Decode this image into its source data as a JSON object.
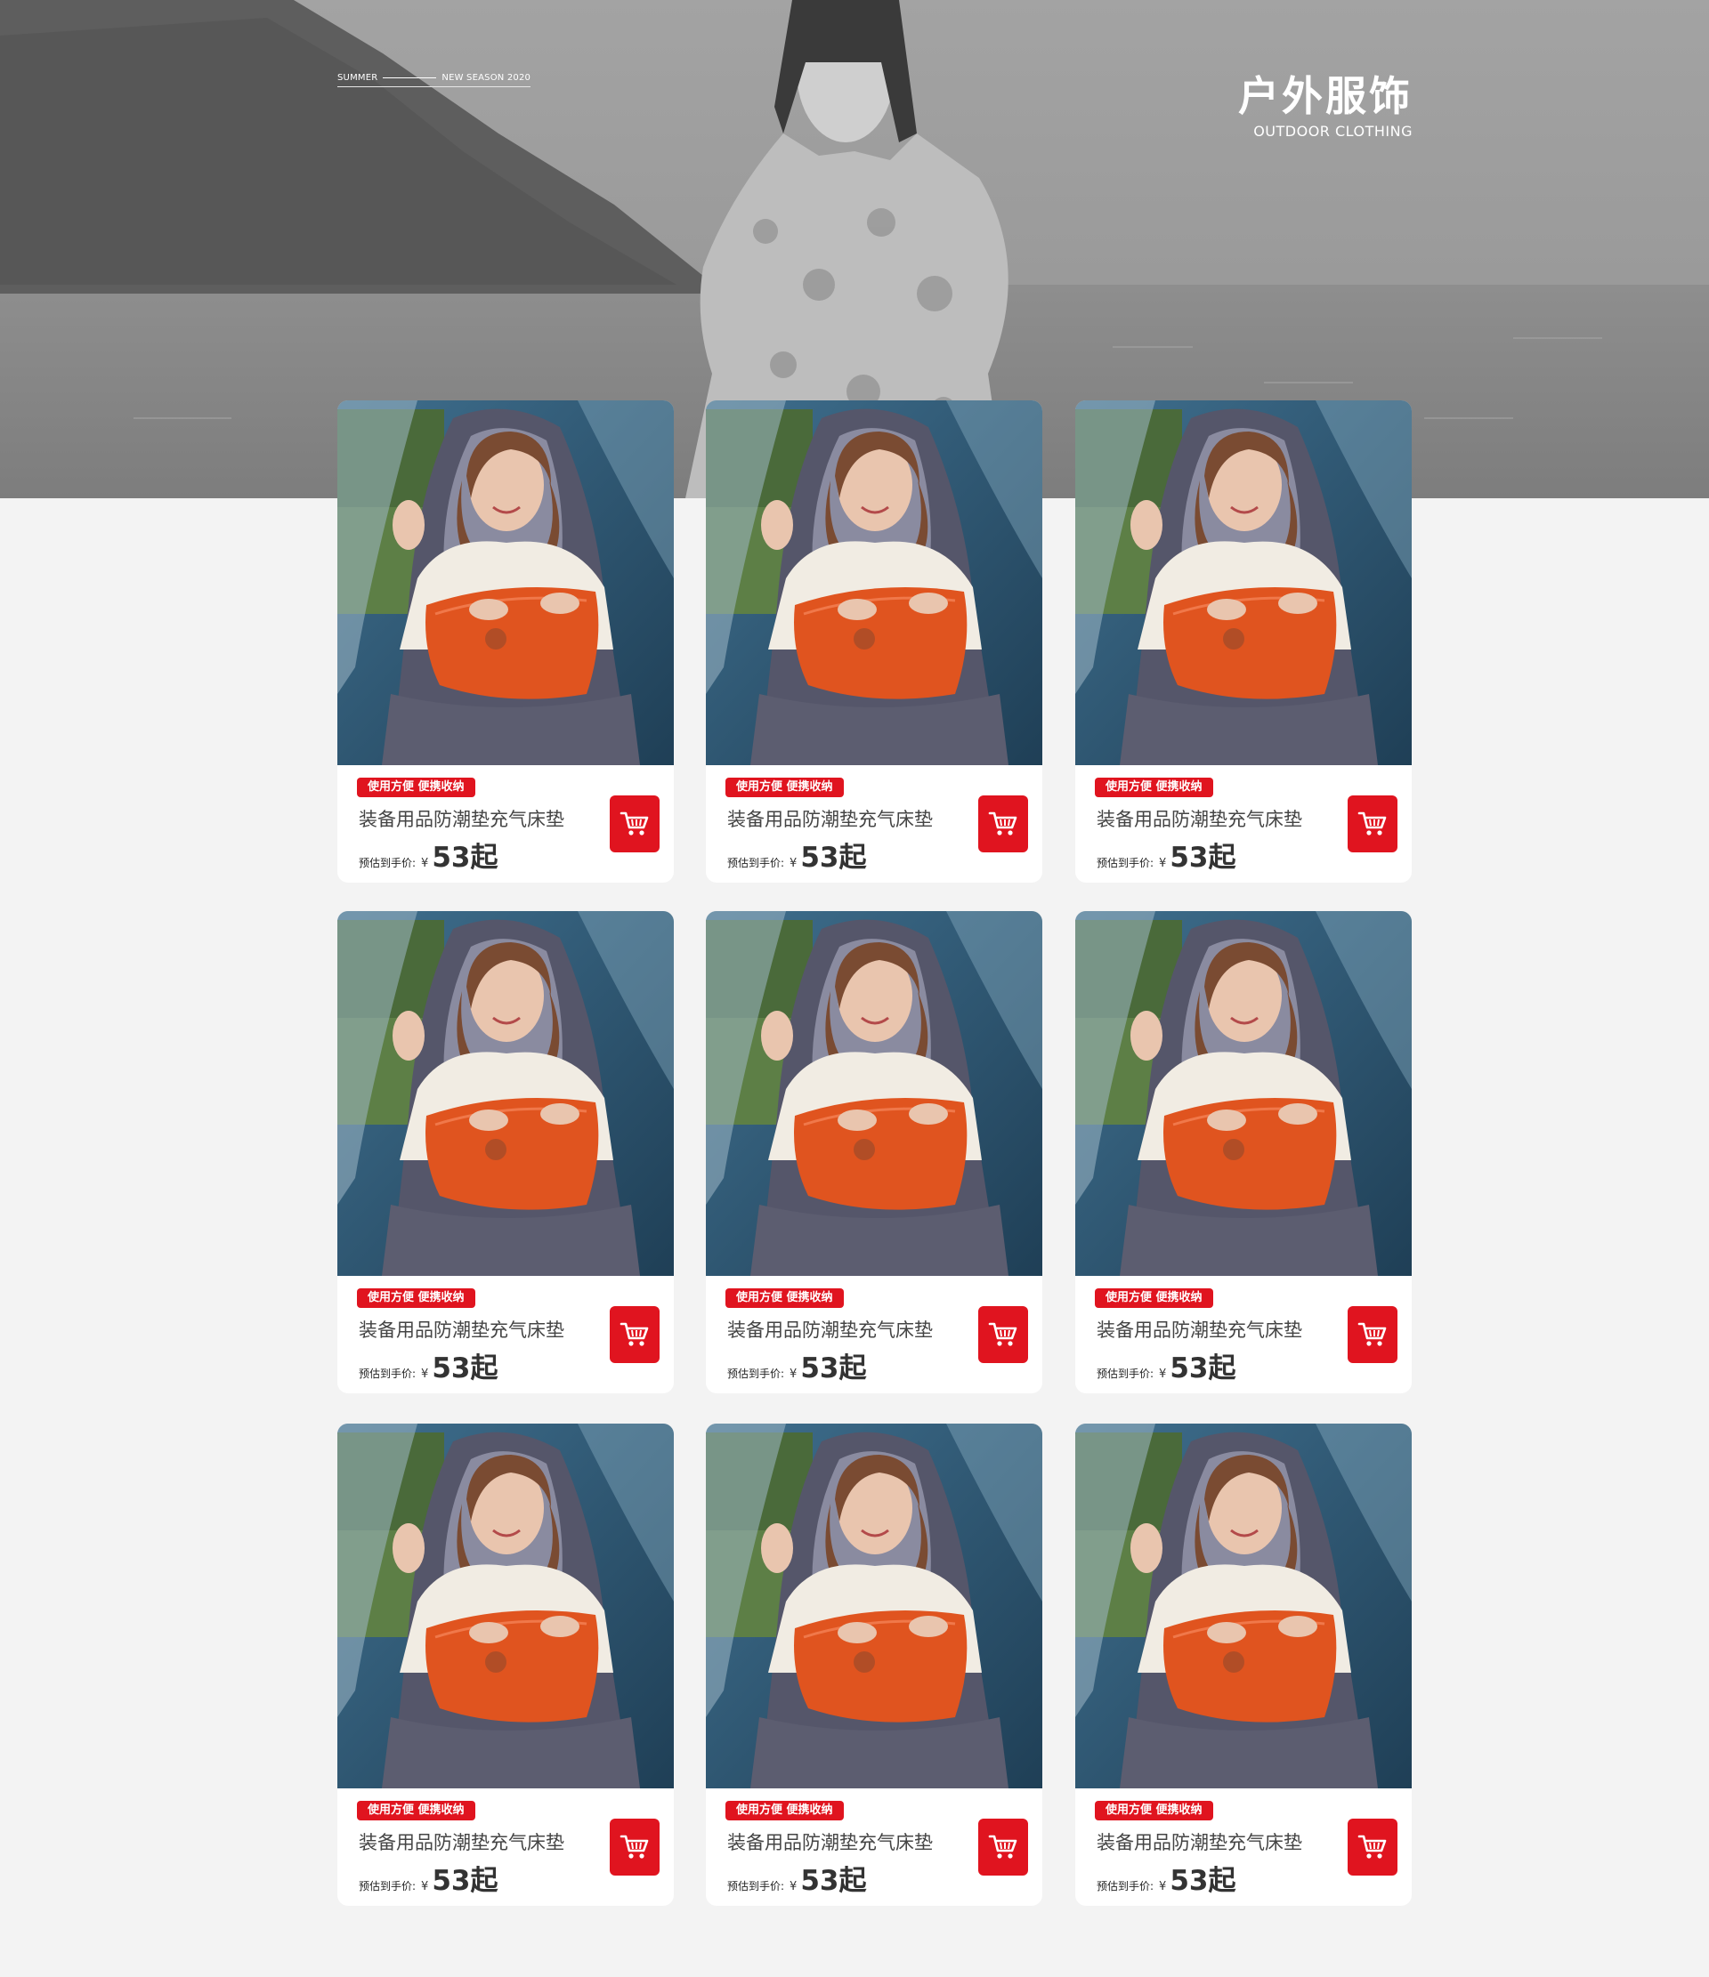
{
  "hero": {
    "season_left": "SUMMER",
    "season_right": "NEW SEASON 2020",
    "title_cn": "户外服饰",
    "title_en": "OUTDOOR CLOTHING"
  },
  "products": [
    {
      "tag": "使用方便 便携收纳",
      "name": "装备用品防潮垫充气床垫",
      "price_label": "预估到手价:",
      "currency": "¥",
      "price": "53起"
    },
    {
      "tag": "使用方便 便携收纳",
      "name": "装备用品防潮垫充气床垫",
      "price_label": "预估到手价:",
      "currency": "¥",
      "price": "53起"
    },
    {
      "tag": "使用方便 便携收纳",
      "name": "装备用品防潮垫充气床垫",
      "price_label": "预估到手价:",
      "currency": "¥",
      "price": "53起"
    },
    {
      "tag": "使用方便 便携收纳",
      "name": "装备用品防潮垫充气床垫",
      "price_label": "预估到手价:",
      "currency": "¥",
      "price": "53起"
    },
    {
      "tag": "使用方便 便携收纳",
      "name": "装备用品防潮垫充气床垫",
      "price_label": "预估到手价:",
      "currency": "¥",
      "price": "53起"
    },
    {
      "tag": "使用方便 便携收纳",
      "name": "装备用品防潮垫充气床垫",
      "price_label": "预估到手价:",
      "currency": "¥",
      "price": "53起"
    },
    {
      "tag": "使用方便 便携收纳",
      "name": "装备用品防潮垫充气床垫",
      "price_label": "预估到手价:",
      "currency": "¥",
      "price": "53起"
    },
    {
      "tag": "使用方便 便携收纳",
      "name": "装备用品防潮垫充气床垫",
      "price_label": "预估到手价:",
      "currency": "¥",
      "price": "53起"
    },
    {
      "tag": "使用方便 便携收纳",
      "name": "装备用品防潮垫充气床垫",
      "price_label": "预估到手价:",
      "currency": "¥",
      "price": "53起"
    }
  ],
  "colors": {
    "accent": "#e0141f",
    "page_bg": "#f3f3f3",
    "card_bg": "#ffffff"
  },
  "icons": {
    "cart": "shopping-cart-icon"
  }
}
